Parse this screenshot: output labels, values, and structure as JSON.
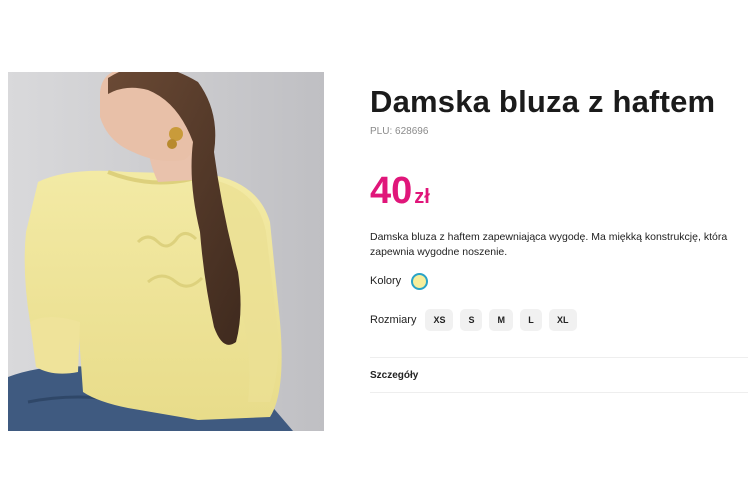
{
  "product": {
    "image_alt": "Kobieta w żółtej bluzie z haftem",
    "title": "Damska bluza z haftem",
    "plu": "PLU: 628696",
    "price": {
      "amount": "40",
      "currency": "zł"
    },
    "description": "Damska bluza z haftem zapewniająca wygodę. Ma miękką konstrukcję, która zapewnia wygodne noszenie.",
    "colors_label": "Kolory",
    "selected_color": "#f6ee9c",
    "sizes_label": "Rozmiary",
    "sizes": [
      "XS",
      "S",
      "M",
      "L",
      "XL"
    ],
    "details_label": "Szczegóły"
  },
  "colors": {
    "price": "#e0167a",
    "swatch_ring": "#2aa3c7"
  }
}
